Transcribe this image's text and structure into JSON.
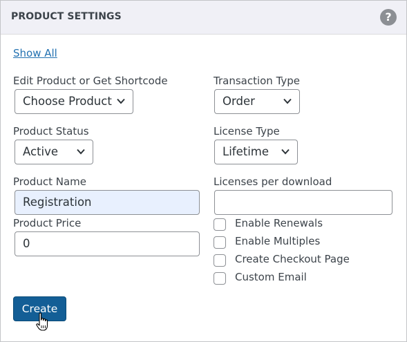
{
  "panel": {
    "title": "PRODUCT SETTINGS",
    "help_icon": "question-mark",
    "help_glyph": "?"
  },
  "show_all": "Show All",
  "fields": {
    "edit_product": {
      "label": "Edit Product or Get Shortcode",
      "value": "Choose Product"
    },
    "transaction_type": {
      "label": "Transaction Type",
      "value": "Order"
    },
    "product_status": {
      "label": "Product Status",
      "value": "Active"
    },
    "license_type": {
      "label": "License Type",
      "value": "Lifetime"
    },
    "product_name": {
      "label": "Product Name",
      "value": "Registration"
    },
    "licenses_per_download": {
      "label": "Licenses per download",
      "value": ""
    },
    "product_price": {
      "label": "Product Price",
      "value": "0"
    }
  },
  "checkboxes": [
    {
      "label": "Enable Renewals",
      "checked": false
    },
    {
      "label": "Enable Multiples",
      "checked": false
    },
    {
      "label": "Create Checkout Page",
      "checked": false
    },
    {
      "label": "Custom Email",
      "checked": false
    }
  ],
  "create_button": "Create",
  "colors": {
    "header_bg": "#f0f0f6",
    "link": "#2271b1",
    "primary_button": "#135e96",
    "autofill_bg": "#e8f0fe"
  }
}
